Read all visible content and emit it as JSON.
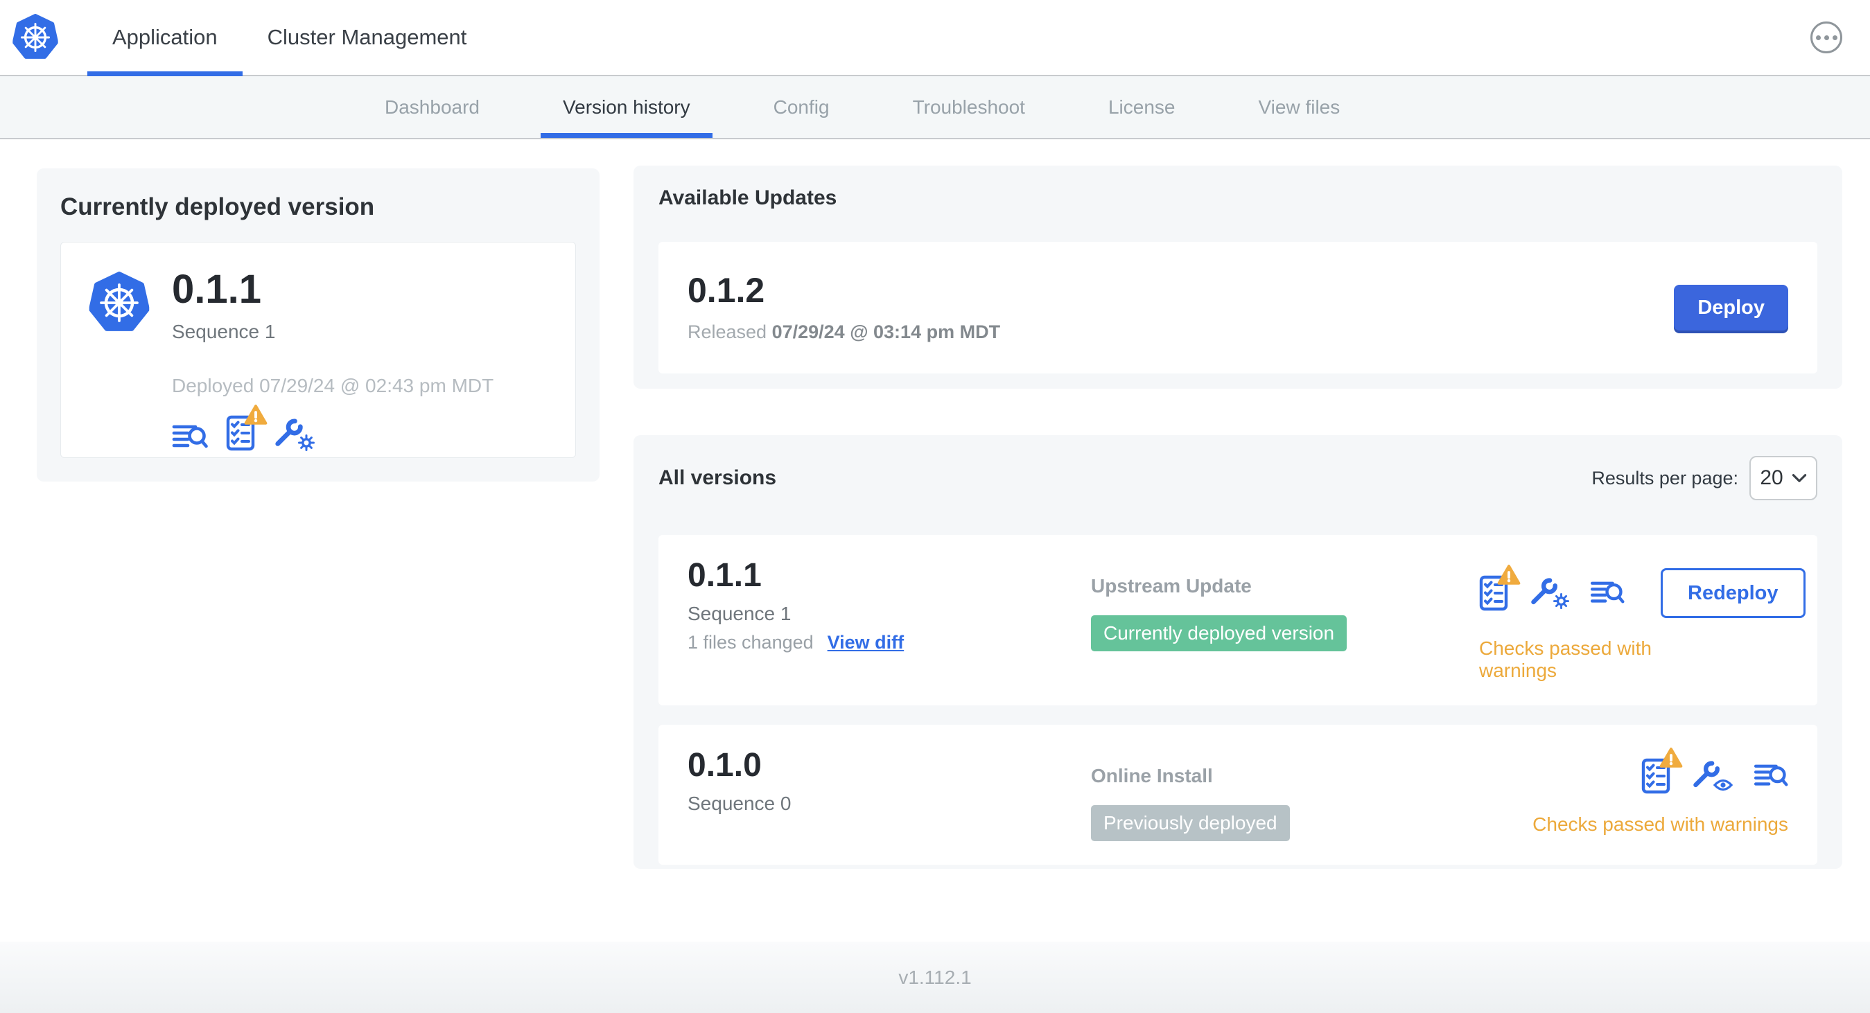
{
  "colors": {
    "accent_blue": "#326de6",
    "warning_amber": "#eca93b",
    "badge_green": "#65c39a",
    "badge_gray": "#b7c2c6"
  },
  "topnav": {
    "tabs": [
      {
        "label": "Application"
      },
      {
        "label": "Cluster Management"
      }
    ]
  },
  "subnav": {
    "tabs": [
      "Dashboard",
      "Version history",
      "Config",
      "Troubleshoot",
      "License",
      "View files"
    ]
  },
  "deployed_card": {
    "title": "Currently deployed version",
    "version": "0.1.1",
    "sequence": "Sequence 1",
    "deployed_at": "Deployed 07/29/24 @ 02:43 pm MDT"
  },
  "available_updates": {
    "title": "Available Updates",
    "version": "0.1.2",
    "released_label": "Released",
    "released_at": "07/29/24 @ 03:14 pm MDT",
    "deploy_button": "Deploy"
  },
  "all_versions": {
    "title": "All versions",
    "results_per_page_label": "Results per page:",
    "results_per_page": "20",
    "rows": [
      {
        "version": "0.1.1",
        "sequence": "Sequence 1",
        "files_changed": "1 files changed",
        "view_diff_link": "View diff",
        "source": "Upstream Update",
        "badge": "Currently deployed version",
        "checks_status": "Checks passed with warnings",
        "action_button": "Redeploy"
      },
      {
        "version": "0.1.0",
        "sequence": "Sequence 0",
        "source": "Online Install",
        "badge": "Previously deployed",
        "checks_status": "Checks passed with warnings"
      }
    ]
  },
  "footer": {
    "app_version": "v1.112.1"
  }
}
